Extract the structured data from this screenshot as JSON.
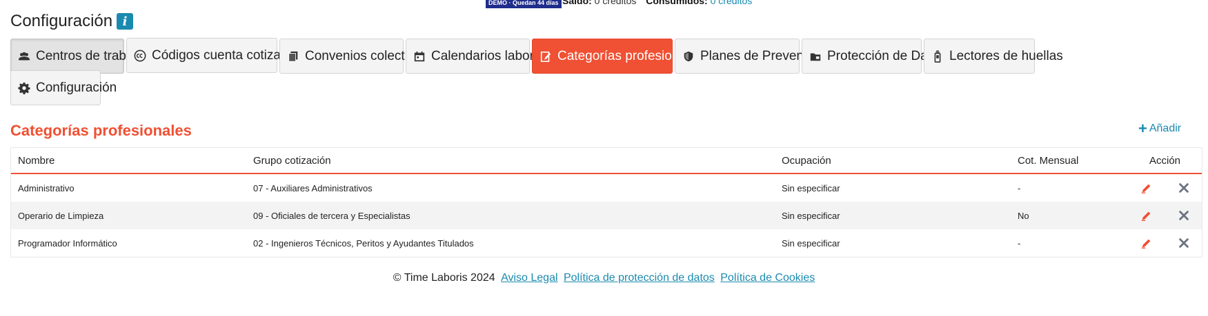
{
  "topbar": {
    "demo_label": "DEMO · Quedan 44 días",
    "saldo_label": "Saldo:",
    "saldo_value": "0 créditos",
    "consumidos_label": "Consumidos:",
    "consumidos_value": "0 créditos"
  },
  "header": {
    "title": "Configuración",
    "info_icon": "i"
  },
  "tabs": [
    {
      "label": "Centros de trabajo",
      "icon": "users-icon"
    },
    {
      "label": "Códigos cuenta cotización",
      "icon": "cc-icon"
    },
    {
      "label": "Convenios colectivos",
      "icon": "copy-icon"
    },
    {
      "label": "Calendarios laborales",
      "icon": "calendar-icon"
    },
    {
      "label": "Categorías profesionales",
      "icon": "edit-doc-icon",
      "active": true
    },
    {
      "label": "Planes de Prevención",
      "icon": "shield-icon"
    },
    {
      "label": "Protección de Datos",
      "icon": "folder-icon"
    },
    {
      "label": "Lectores de huellas",
      "icon": "reader-icon"
    },
    {
      "label": "Configuración",
      "icon": "gear-icon"
    }
  ],
  "section": {
    "title": "Categorías profesionales",
    "add_label": "Añadir"
  },
  "table": {
    "headers": [
      "Nombre",
      "Grupo cotización",
      "Ocupación",
      "Cot. Mensual",
      "Acción"
    ],
    "rows": [
      [
        "Administrativo",
        "07 - Auxiliares Administrativos",
        "Sin especificar",
        "-"
      ],
      [
        "Operario de Limpieza",
        "09 - Oficiales de tercera y Especialistas",
        "Sin especificar",
        "No"
      ],
      [
        "Programador Informático",
        "02 - Ingenieros Técnicos, Peritos y Ayudantes Titulados",
        "Sin especificar",
        "-"
      ]
    ]
  },
  "footer": {
    "copyright": "© Time Laboris 2024",
    "links": [
      "Aviso Legal",
      "Política de protección de datos",
      "Política de Cookies"
    ]
  },
  "colors": {
    "accent": "#f05033",
    "link": "#1a8ab0",
    "demo_badge": "#1f2d8c"
  }
}
